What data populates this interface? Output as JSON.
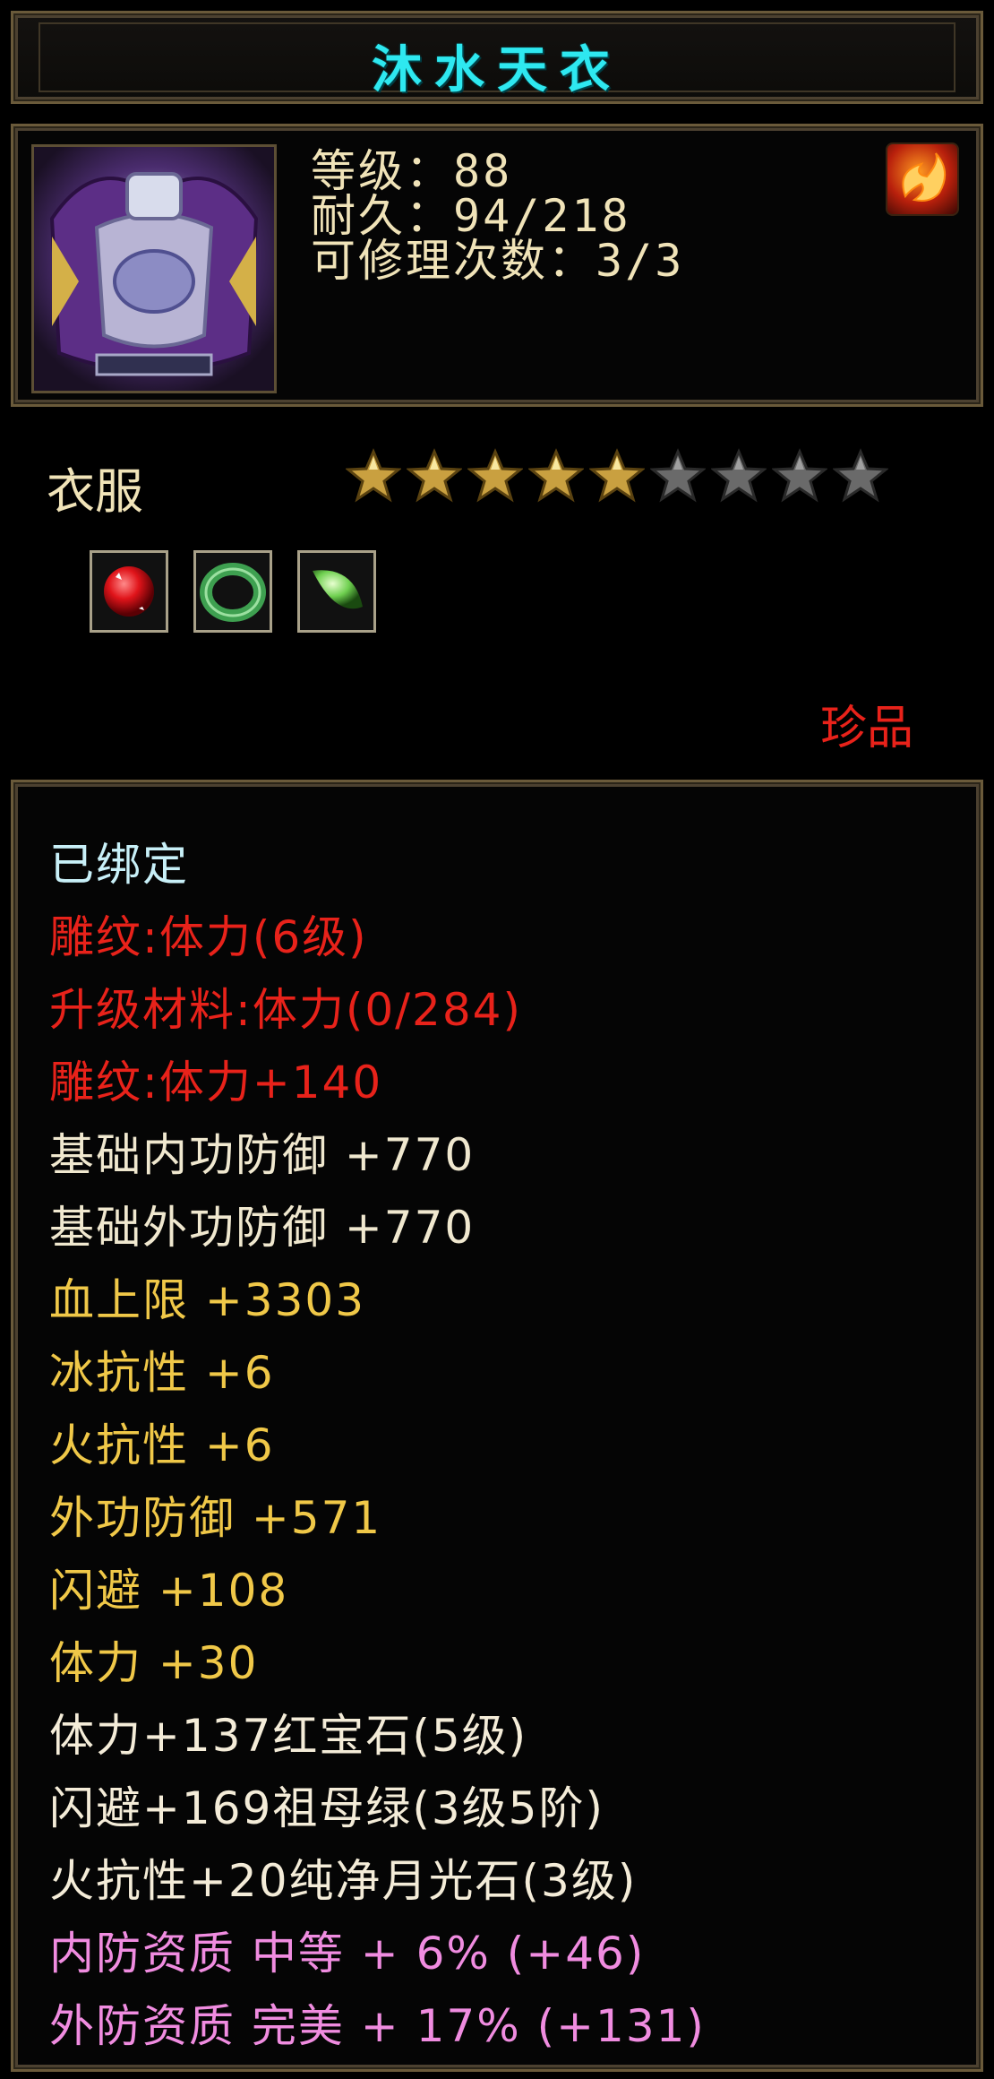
{
  "item": {
    "name": "沐水天衣",
    "stats": [
      "等级：88",
      "耐久：94/218",
      "可修理次数：3/3"
    ],
    "type": "衣服",
    "stars": {
      "total": 9,
      "filled": 5
    },
    "gems": [
      {
        "icon": "ruby-gem-icon",
        "color": "#e0141a"
      },
      {
        "icon": "jade-ring-icon",
        "color": "#3ea050"
      },
      {
        "icon": "moonstone-gem-icon",
        "color": "#6fd050"
      }
    ],
    "rarity": "珍品"
  },
  "attributes": [
    {
      "text": "已绑定",
      "color": "#c8f0f8"
    },
    {
      "text": "雕纹:体力(6级)",
      "color": "#e8221a"
    },
    {
      "text": "升级材料:体力(0/284)",
      "color": "#e8221a"
    },
    {
      "text": "雕纹:体力+140",
      "color": "#e8221a"
    },
    {
      "text": "基础内功防御 +770",
      "color": "#f0e8cf"
    },
    {
      "text": "基础外功防御 +770",
      "color": "#f0e8cf"
    },
    {
      "text": "血上限 +3303",
      "color": "#f0c848"
    },
    {
      "text": "冰抗性 +6",
      "color": "#f0c848"
    },
    {
      "text": "火抗性 +6",
      "color": "#f0c848"
    },
    {
      "text": "外功防御 +571",
      "color": "#f0c848"
    },
    {
      "text": "闪避 +108",
      "color": "#f0c848"
    },
    {
      "text": "体力 +30",
      "color": "#f0c848"
    },
    {
      "text": "体力+137红宝石(5级)",
      "color": "#f4ecd8"
    },
    {
      "text": "闪避+169祖母绿(3级5阶)",
      "color": "#f4ecd8"
    },
    {
      "text": "火抗性+20纯净月光石(3级)",
      "color": "#f4ecd8"
    },
    {
      "text": "内防资质 中等 + 6% (+46)",
      "color": "#f08ce0"
    },
    {
      "text": "外防资质 完美 + 17% (+131)",
      "color": "#f08ce0"
    }
  ],
  "colors": {
    "title": "#2ee8f0",
    "frame": "#6a5a3a",
    "star_filled": "#c9a040",
    "star_empty": "#6a6a6a"
  }
}
